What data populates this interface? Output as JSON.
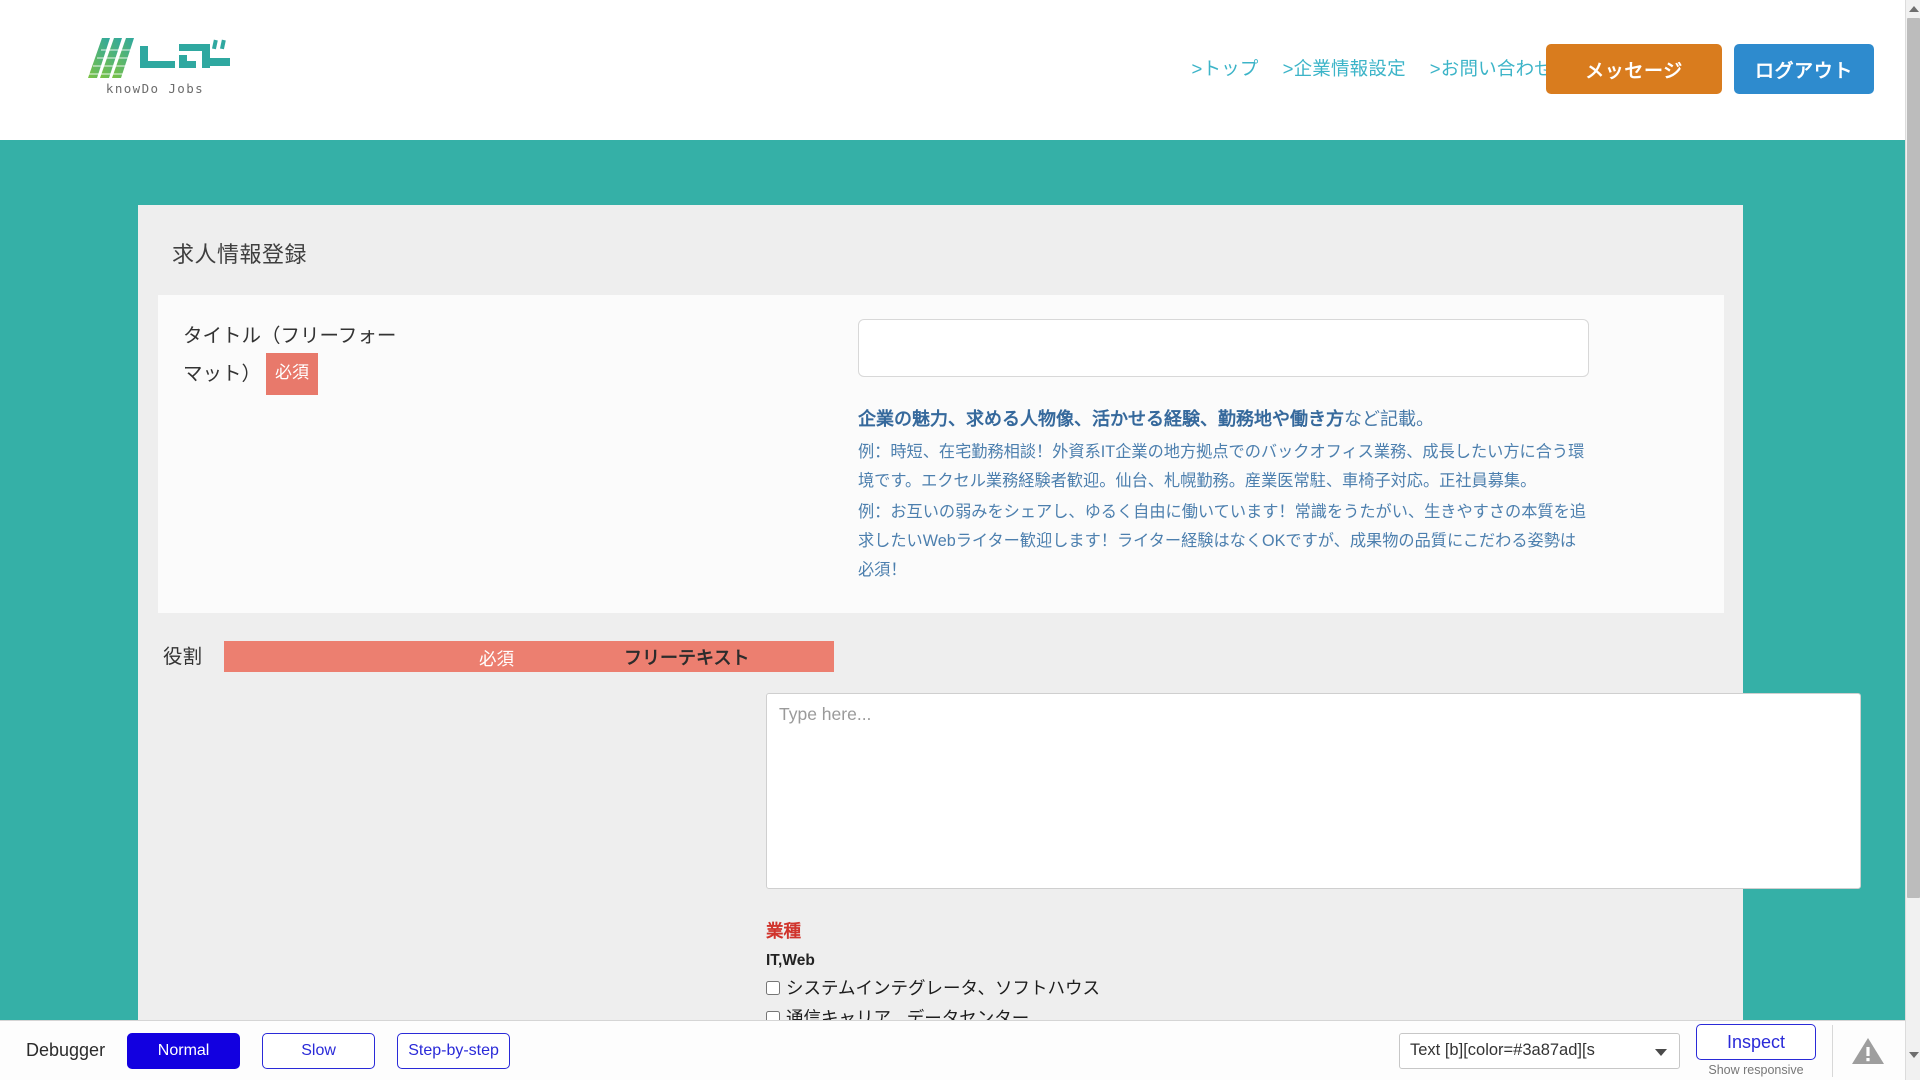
{
  "header": {
    "logo_text": "knowDo Jobs",
    "nav": [
      {
        "label": ">トップ",
        "name": "nav-top"
      },
      {
        "label": ">企業情報設定",
        "name": "nav-company-settings"
      },
      {
        "label": ">お問い合わせ",
        "name": "nav-contact"
      }
    ],
    "message_button": "メッセージ",
    "logout_button": "ログアウト"
  },
  "card": {
    "title": "求人情報登録",
    "title_field": {
      "label": "タイトル（フリーフォーマット）",
      "required_badge": "必須",
      "input_value": "",
      "input_placeholder": ""
    },
    "hint": {
      "head_bold": "企業の魅力、求める人物像、活かせる経験、勤務地や働き方",
      "head_plain": "など記載。",
      "example1": "例：時短、在宅勤務相談！外資系IT企業の地方拠点でのバックオフィス業務、成長したい方に合う環境です。エクセル業務経験者歓迎。仙台、札幌勤務。産業医常駐、車椅子対応。正社員募集。",
      "example2": "例：お互いの弱みをシェアし、ゆるく自由に働いています！常識をうたがい、生きやすさの本質を追求したいWebライター歓迎します！ライター経験はなくOKですが、成果物の品質にこだわる姿勢は必須！"
    },
    "role_field": {
      "label": "役割",
      "bar_required": "必須",
      "bar_freetext": "フリーテキスト",
      "textarea_value": "",
      "textarea_placeholder": "Type here..."
    },
    "industry": {
      "heading": "業種",
      "group_label": "IT,Web",
      "options": [
        {
          "label": "システムインテグレータ、ソフトハウス",
          "checked": false
        },
        {
          "label": "通信キャリア、データセンター",
          "checked": false
        }
      ]
    }
  },
  "debugger": {
    "label": "Debugger",
    "buttons": [
      {
        "label": "Normal",
        "style": "primary",
        "name": "debug-speed-normal"
      },
      {
        "label": "Slow",
        "style": "ghost",
        "name": "debug-speed-slow"
      },
      {
        "label": "Step-by-step",
        "style": "ghost",
        "name": "debug-speed-step"
      }
    ],
    "select_value": "Text [b][color=#3a87ad][s",
    "inspect_button": "Inspect",
    "show_responsive": "Show responsive"
  },
  "colors": {
    "teal": "#35b0a7",
    "orange": "#d97c1e",
    "blue": "#2e8bce",
    "salmon": "#ec7f70",
    "hint_blue": "#4c7fae",
    "red": "#d0342c",
    "debug_blue": "#1200e0"
  }
}
